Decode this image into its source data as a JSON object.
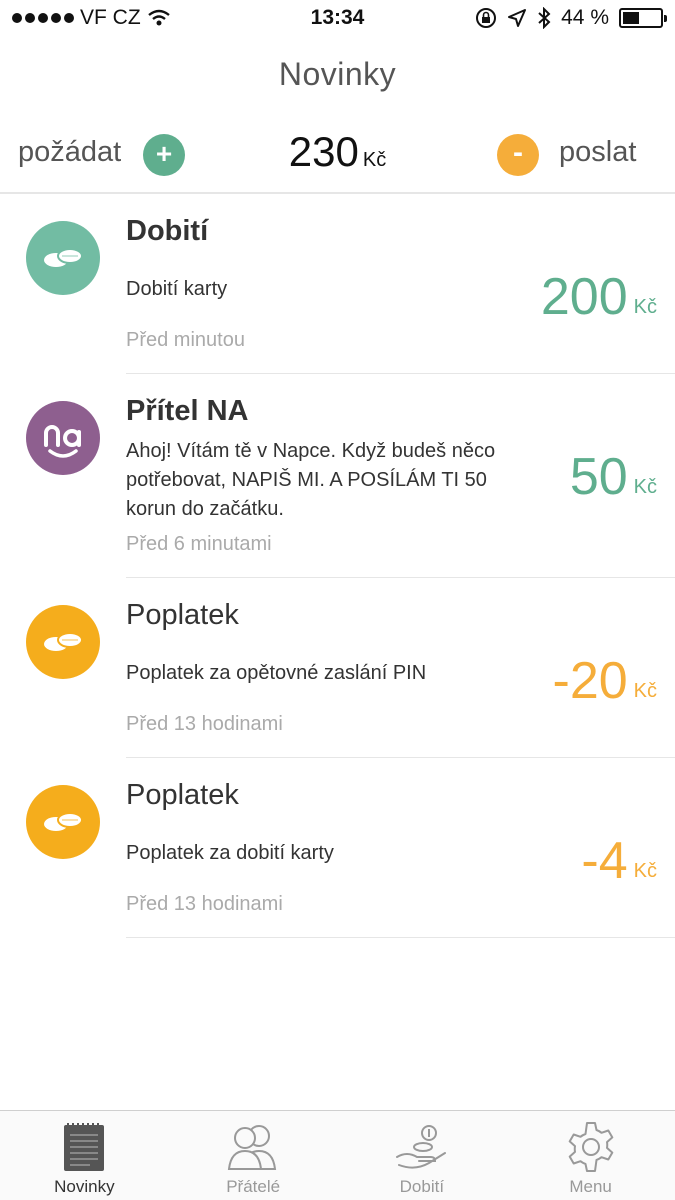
{
  "status_bar": {
    "carrier": "VF CZ",
    "time": "13:34",
    "battery": "44 %",
    "battery_level": 0.44
  },
  "header": {
    "title": "Novinky"
  },
  "balance_bar": {
    "request_label": "požádat",
    "request_button": "+",
    "balance_amount": "230",
    "balance_currency": "Kč",
    "send_button": "-",
    "send_label": "poslat"
  },
  "feed": [
    {
      "title": "Dobití",
      "description": "Dobití karty",
      "time": "Před minutou",
      "amount": "200",
      "currency": "Kč",
      "avatar": "coins-icon",
      "avatar_color": "#72bca3",
      "amount_color": "#5fae8e"
    },
    {
      "title": "Přítel NA",
      "description": "Ahoj! Vítám tě v Napce. Když budeš něco potřebovat, NAPIŠ MI. A POSÍLÁM TI 50 korun do začátku.",
      "time": "Před 6 minutami",
      "amount": "50",
      "currency": "Kč",
      "avatar": "na-logo-icon",
      "avatar_color": "#8e5f8f",
      "amount_color": "#5fae8e"
    },
    {
      "title": "Poplatek",
      "description": "Poplatek za opětovné zaslání PIN",
      "time": "Před 13 hodinami",
      "amount": "-20",
      "currency": "Kč",
      "avatar": "coins-icon",
      "avatar_color": "#f5ad1c",
      "amount_color": "#f5ad3a"
    },
    {
      "title": "Poplatek",
      "description": "Poplatek za dobití karty",
      "time": "Před 13 hodinami",
      "amount": "-4",
      "currency": "Kč",
      "avatar": "coins-icon",
      "avatar_color": "#f5ad1c",
      "amount_color": "#f5ad3a"
    }
  ],
  "tab_bar": {
    "tabs": [
      {
        "label": "Novinky",
        "icon": "news-icon",
        "active": true
      },
      {
        "label": "Přátelé",
        "icon": "friends-icon",
        "active": false
      },
      {
        "label": "Dobití",
        "icon": "topup-hand-icon",
        "active": false
      },
      {
        "label": "Menu",
        "icon": "gear-icon",
        "active": false
      }
    ]
  }
}
